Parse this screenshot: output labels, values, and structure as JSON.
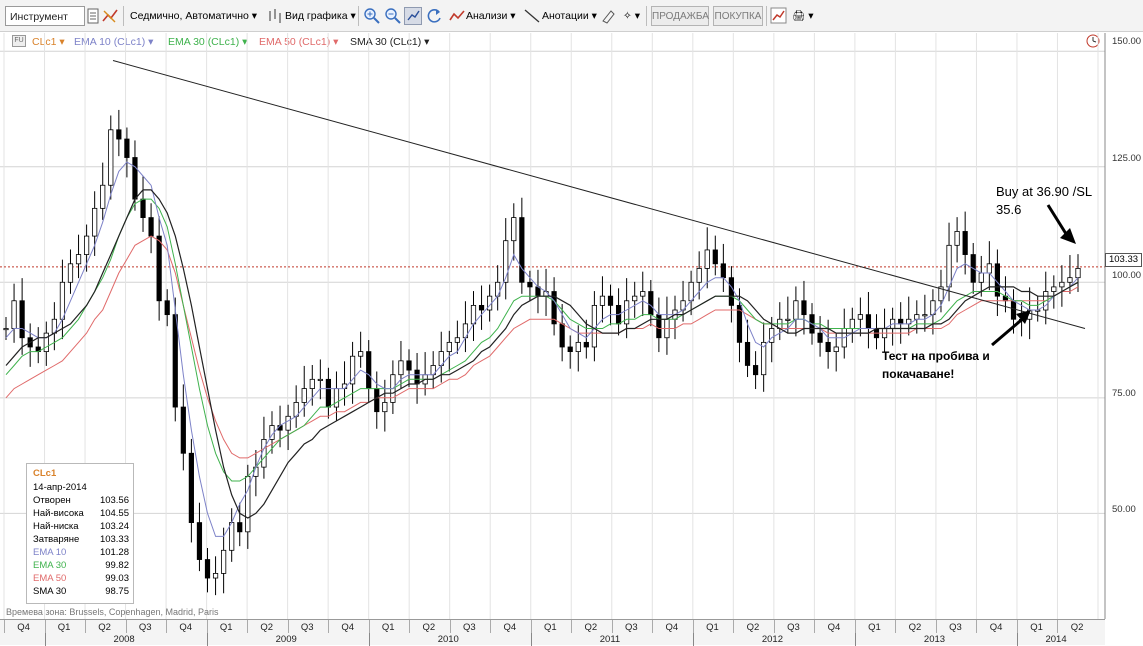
{
  "toolbar": {
    "instrument_placeholder": "Инструмент",
    "period": "Седмично, Автоматично",
    "chart_type": "Вид графика",
    "analysis": "Анализи",
    "annotations": "Анотации",
    "sell": "ПРОДАЖБА",
    "buy": "ПОКУПКА"
  },
  "legend": {
    "main": "CLc1",
    "ema10": "EMA 10 (CLc1)",
    "ema30": "EMA 30 (CLc1)",
    "ema50": "EMA 50 (CLc1)",
    "sma30": "SMA 30 (CLc1)",
    "colors": {
      "main": "#d9822b",
      "ema10": "#7d82c8",
      "ema30": "#3fb24d",
      "ema50": "#e06a6a",
      "sma30": "#222222"
    }
  },
  "info": {
    "symbol": "CLc1",
    "date": "14-апр-2014",
    "rows": [
      {
        "k": "Отворен",
        "v": "103.56"
      },
      {
        "k": "Най-висока",
        "v": "104.55"
      },
      {
        "k": "Най-ниска",
        "v": "103.24"
      },
      {
        "k": "Затваряне",
        "v": "103.33"
      },
      {
        "k": "EMA 10",
        "v": "101.28"
      },
      {
        "k": "EMA 30",
        "v": "99.82"
      },
      {
        "k": "EMA 50",
        "v": "99.03"
      },
      {
        "k": "SMA 30",
        "v": "98.75"
      }
    ]
  },
  "timezone": "Времева зона: Brussels, Copenhagen, Madrid, Paris",
  "price_tag": "103.33",
  "annotations": {
    "buy_line1": "Buy at 36.90 /SL",
    "buy_line2": "35.6",
    "test_line1": "Тест на пробива и",
    "test_line2": "покачаване!"
  },
  "chart_data": {
    "type": "line",
    "title": "",
    "y_ticks": [
      "150.00",
      "125.00",
      "100.00",
      "75.00",
      "50.00"
    ],
    "ylim": [
      28,
      152
    ],
    "quarters": [
      "Q4",
      "Q1",
      "Q2",
      "Q3",
      "Q4",
      "Q1",
      "Q2",
      "Q3",
      "Q4",
      "Q1",
      "Q2",
      "Q3",
      "Q4",
      "Q1",
      "Q2",
      "Q3",
      "Q4",
      "Q1",
      "Q2",
      "Q3",
      "Q4",
      "Q1",
      "Q2",
      "Q3",
      "Q4",
      "Q1",
      "Q2"
    ],
    "years": [
      "2008",
      "2009",
      "2010",
      "2011",
      "2012",
      "2013",
      "2014"
    ],
    "close": [
      90,
      96,
      88,
      86,
      85,
      89,
      92,
      100,
      104,
      106,
      110,
      116,
      121,
      133,
      131,
      127,
      118,
      114,
      110,
      96,
      93,
      73,
      63,
      48,
      40,
      36,
      37,
      42,
      48,
      46,
      58,
      60,
      66,
      69,
      68,
      71,
      74,
      77,
      79,
      79,
      73,
      77,
      78,
      84,
      85,
      77,
      72,
      74,
      80,
      83,
      81,
      78,
      80,
      82,
      85,
      87,
      88,
      91,
      95,
      94,
      97,
      100,
      109,
      114,
      100,
      99,
      97,
      98,
      91,
      86,
      85,
      87,
      86,
      95,
      97,
      95,
      91,
      96,
      97,
      98,
      93,
      88,
      92,
      94,
      96,
      100,
      103,
      107,
      104,
      101,
      95,
      87,
      82,
      80,
      87,
      90,
      92,
      92,
      96,
      93,
      89,
      87,
      85,
      86,
      90,
      92,
      93,
      90,
      88,
      90,
      92,
      91,
      92,
      93,
      93,
      96,
      99,
      108,
      111,
      106,
      100,
      102,
      104,
      97,
      96,
      92,
      92,
      94,
      94,
      98,
      99,
      100,
      101,
      103
    ],
    "ema10": [
      88,
      90,
      90,
      89,
      88,
      88,
      89,
      92,
      96,
      100,
      104,
      108,
      113,
      119,
      124,
      126,
      125,
      123,
      121,
      114,
      108,
      94,
      80,
      68,
      58,
      50,
      45,
      45,
      48,
      52,
      55,
      60,
      64,
      67,
      69,
      70,
      71,
      73,
      75,
      77,
      77,
      77,
      77,
      79,
      81,
      80,
      78,
      77,
      77,
      79,
      80,
      80,
      80,
      80,
      82,
      84,
      85,
      88,
      91,
      93,
      95,
      97,
      101,
      106,
      103,
      101,
      99,
      98,
      96,
      93,
      90,
      89,
      88,
      90,
      92,
      93,
      93,
      94,
      95,
      96,
      95,
      93,
      93,
      93,
      94,
      96,
      98,
      100,
      101,
      101,
      99,
      96,
      91,
      87,
      86,
      88,
      89,
      90,
      92,
      92,
      91,
      90,
      88,
      88,
      88,
      89,
      90,
      90,
      90,
      90,
      91,
      91,
      91,
      92,
      92,
      93,
      95,
      99,
      103,
      104,
      103,
      102,
      102,
      100,
      98,
      96,
      95,
      94,
      94,
      95,
      97,
      98,
      99,
      101
    ],
    "ema30": [
      80,
      82,
      84,
      85,
      85,
      86,
      87,
      88,
      90,
      92,
      95,
      98,
      101,
      105,
      110,
      114,
      117,
      118,
      118,
      116,
      112,
      104,
      95,
      86,
      77,
      69,
      63,
      59,
      57,
      57,
      58,
      60,
      62,
      64,
      66,
      67,
      68,
      69,
      71,
      73,
      73,
      74,
      75,
      76,
      77,
      77,
      77,
      77,
      77,
      78,
      79,
      79,
      79,
      79,
      80,
      81,
      82,
      83,
      85,
      87,
      88,
      90,
      93,
      96,
      97,
      97,
      97,
      97,
      96,
      94,
      92,
      91,
      90,
      90,
      90,
      91,
      91,
      92,
      92,
      93,
      93,
      92,
      92,
      92,
      93,
      94,
      95,
      96,
      97,
      97,
      97,
      96,
      94,
      92,
      91,
      91,
      91,
      91,
      92,
      92,
      91,
      91,
      90,
      90,
      90,
      90,
      90,
      90,
      90,
      90,
      90,
      90,
      90,
      91,
      91,
      91,
      92,
      94,
      96,
      97,
      98,
      98,
      98,
      98,
      97,
      96,
      96,
      95,
      95,
      96,
      97,
      98,
      99,
      100
    ],
    "ema50": [
      75,
      77,
      78,
      79,
      80,
      81,
      82,
      83,
      85,
      87,
      89,
      92,
      94,
      98,
      102,
      105,
      108,
      109,
      110,
      109,
      107,
      102,
      95,
      88,
      81,
      75,
      70,
      66,
      63,
      62,
      62,
      63,
      64,
      65,
      66,
      67,
      68,
      69,
      70,
      71,
      71,
      72,
      72,
      73,
      74,
      74,
      75,
      75,
      75,
      76,
      77,
      77,
      77,
      77,
      78,
      79,
      79,
      80,
      82,
      83,
      84,
      86,
      88,
      90,
      91,
      92,
      92,
      92,
      92,
      91,
      90,
      89,
      89,
      89,
      89,
      89,
      89,
      90,
      90,
      90,
      91,
      90,
      90,
      90,
      91,
      91,
      92,
      93,
      94,
      94,
      94,
      94,
      93,
      92,
      91,
      91,
      90,
      90,
      90,
      90,
      90,
      90,
      89,
      89,
      89,
      89,
      89,
      89,
      89,
      89,
      89,
      89,
      89,
      90,
      90,
      90,
      90,
      91,
      93,
      94,
      95,
      96,
      96,
      96,
      96,
      96,
      96,
      96,
      96,
      96,
      97,
      98,
      98,
      99
    ],
    "sma30": [
      82,
      84,
      86,
      87,
      88,
      88,
      89,
      90,
      91,
      93,
      95,
      98,
      102,
      106,
      110,
      114,
      118,
      120,
      120,
      118,
      115,
      110,
      103,
      95,
      86,
      77,
      68,
      60,
      54,
      50,
      49,
      50,
      52,
      55,
      58,
      61,
      63,
      65,
      66,
      68,
      69,
      70,
      71,
      72,
      73,
      74,
      75,
      76,
      76,
      77,
      78,
      78,
      79,
      79,
      80,
      80,
      81,
      82,
      83,
      85,
      86,
      88,
      90,
      93,
      95,
      96,
      97,
      97,
      97,
      96,
      95,
      93,
      91,
      90,
      89,
      89,
      89,
      90,
      90,
      91,
      92,
      92,
      92,
      93,
      93,
      94,
      95,
      96,
      97,
      97,
      97,
      97,
      96,
      94,
      92,
      91,
      90,
      89,
      89,
      90,
      90,
      90,
      90,
      89,
      89,
      89,
      89,
      89,
      90,
      90,
      90,
      90,
      90,
      90,
      90,
      91,
      91,
      92,
      94,
      96,
      97,
      98,
      99,
      99,
      99,
      99,
      98,
      98,
      97,
      97,
      97,
      98,
      99,
      100
    ],
    "trendline": [
      [
        0,
        148
      ],
      [
        1,
        90
      ]
    ],
    "h_line": 103.33
  }
}
